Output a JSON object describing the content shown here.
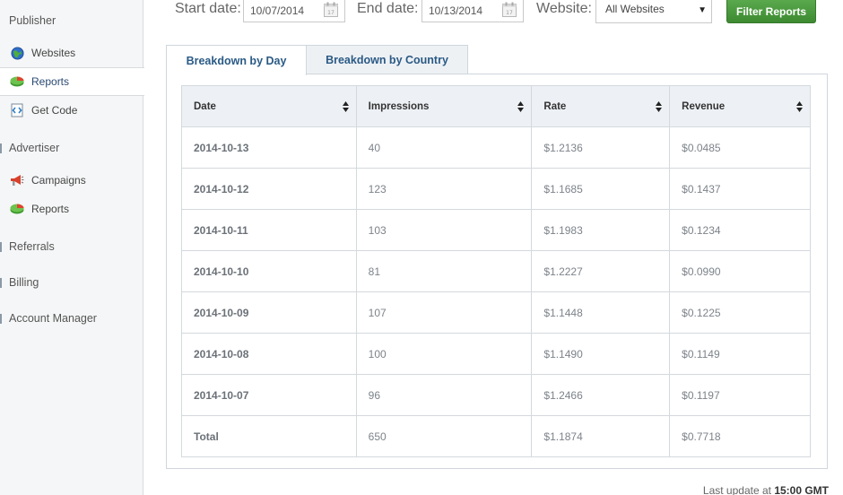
{
  "sidebar": {
    "publisher_label": "Publisher",
    "publisher_items": [
      {
        "label": "Websites",
        "icon": "globe-icon"
      },
      {
        "label": "Reports",
        "icon": "chart-icon",
        "active": true
      },
      {
        "label": "Get Code",
        "icon": "code-icon"
      }
    ],
    "advertiser_label": "Advertiser",
    "advertiser_items": [
      {
        "label": "Campaigns",
        "icon": "megaphone-icon"
      },
      {
        "label": "Reports",
        "icon": "chart-icon"
      }
    ],
    "referrals_label": "Referrals",
    "billing_label": "Billing",
    "account_manager_label": "Account Manager"
  },
  "filter": {
    "start_label": "Start date:",
    "start_value": "10/07/2014",
    "end_label": "End date:",
    "end_value": "10/13/2014",
    "website_label": "Website:",
    "website_value": "All Websites",
    "button_label": "Filter Reports"
  },
  "tabs": [
    {
      "label": "Breakdown by Day",
      "active": true
    },
    {
      "label": "Breakdown by Country",
      "active": false
    }
  ],
  "table": {
    "headers": [
      "Date",
      "Impressions",
      "Rate",
      "Revenue"
    ],
    "rows": [
      [
        "2014-10-13",
        "40",
        "$1.2136",
        "$0.0485"
      ],
      [
        "2014-10-12",
        "123",
        "$1.1685",
        "$0.1437"
      ],
      [
        "2014-10-11",
        "103",
        "$1.1983",
        "$0.1234"
      ],
      [
        "2014-10-10",
        "81",
        "$1.2227",
        "$0.0990"
      ],
      [
        "2014-10-09",
        "107",
        "$1.1448",
        "$0.1225"
      ],
      [
        "2014-10-08",
        "100",
        "$1.1490",
        "$0.1149"
      ],
      [
        "2014-10-07",
        "96",
        "$1.2466",
        "$0.1197"
      ],
      [
        "Total",
        "650",
        "$1.1874",
        "$0.7718"
      ]
    ]
  },
  "footer": {
    "prefix": "Last update at",
    "time": "15:00 GMT"
  },
  "colors": {
    "accent_green": "#4a9a3f",
    "tab_text": "#2a5a85",
    "header_bg": "#edf1f5"
  }
}
